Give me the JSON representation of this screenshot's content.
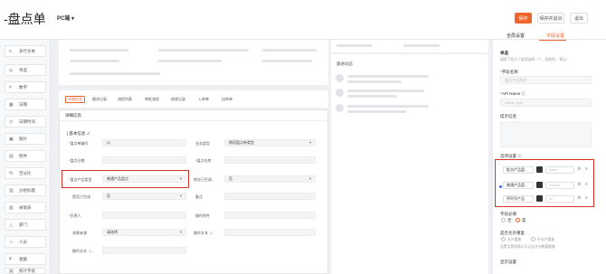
{
  "app": {
    "title": "-盘点单",
    "platform": "PC端 ▾"
  },
  "toolbar": {
    "save": "保存",
    "save_exit": "保存并退出",
    "exit": "退出"
  },
  "sidebar": {
    "items": [
      {
        "icon": "≡",
        "label": "多行文本"
      },
      {
        "icon": "◎",
        "label": "单选"
      },
      {
        "icon": "#",
        "label": "数字"
      },
      {
        "icon": "▦",
        "label": "日期"
      },
      {
        "icon": "◷",
        "label": "日期时间"
      },
      {
        "icon": "▣",
        "label": "图片"
      },
      {
        "icon": "▤",
        "label": "附件"
      },
      {
        "icon": "%",
        "label": "百分比"
      },
      {
        "icon": "▥",
        "label": "分组标题"
      },
      {
        "icon": "▥",
        "label": "关联表"
      },
      {
        "icon": "△",
        "label": "部门"
      },
      {
        "icon": "⚇",
        "label": "人员"
      },
      {
        "icon": "¥",
        "label": "金额"
      },
      {
        "icon": "▤",
        "label": "统计字段"
      }
    ]
  },
  "canvas": {
    "section_title": "跟进动态",
    "tabs": [
      "详细信息",
      "跟进记录",
      "流程列表",
      "审批流程",
      "修改记录",
      "入库单",
      "出库单"
    ],
    "form_header": "详细信息",
    "subsection": "| 基本信息  ∠",
    "fields": {
      "code_label": "盘点单编号",
      "code_value": "以",
      "business_type_label": "业务类型",
      "business_type_value": "期初盘点单类型",
      "date_label": "盘点日期",
      "warehouse_label": "盘点仓库",
      "product_type_label": "盘点产品类型",
      "product_type_value": "普通产品盘点",
      "inventory_generated_label": "库存已生成...",
      "inventory_generated_value": "否",
      "ledger_generated_label": "是否已生成",
      "ledger_generated_value": "否",
      "remark_label": "备注",
      "person_label": "负责人",
      "attachment_label": "操作附件",
      "source_label": "关联来源",
      "source_value": "请选择",
      "ext1_label": "操作文本（...",
      "ext2_label": "操作文本（..."
    }
  },
  "props": {
    "tab_global": "全局设置",
    "tab_field": "字段设置",
    "type_title": "单选",
    "type_note": "请用下拉几个选项选择一个，系统将，\"默认\"",
    "name_label": "字段名称",
    "name_placeholder": "盘点产品类型",
    "api_label": "API Name ⓘ",
    "api_placeholder": "check_type",
    "hint_label": "提示信息",
    "options_label": "选项设置 ⓘ",
    "options": [
      {
        "label": "批次产品盘...",
        "value": "batch"
      },
      {
        "label": "普通产品盘...",
        "value": "normal"
      },
      {
        "label": "序列号产品",
        "value": "sn"
      }
    ],
    "required_label": "字段必填",
    "required_no": "否",
    "required_yes": "是",
    "unique_label": "是否允许重复",
    "unique_allow": "允许重复",
    "unique_deny": "不允许重复",
    "unique_note": "设置为是则表示可以允许与数据重复",
    "more_label": "显示设置"
  }
}
